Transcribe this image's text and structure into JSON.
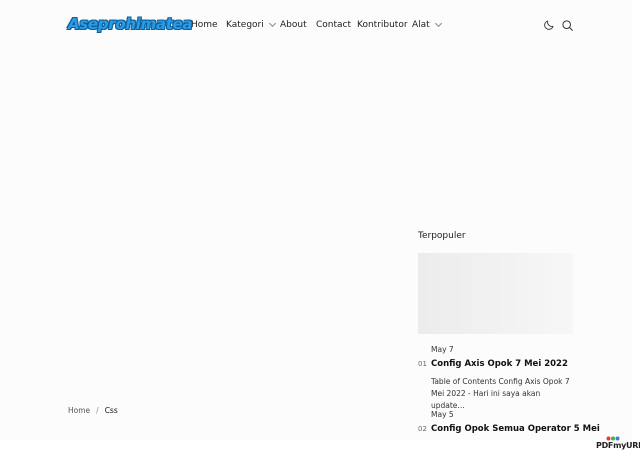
{
  "header": {
    "logo_text": "Aseprohimatea",
    "nav": [
      {
        "label": "Home",
        "has_dropdown": false
      },
      {
        "label": "Kategori",
        "has_dropdown": true
      },
      {
        "label": "About",
        "has_dropdown": false
      },
      {
        "label": "Contact",
        "has_dropdown": false
      },
      {
        "label": "Kontributor",
        "has_dropdown": false
      },
      {
        "label": "Alat",
        "has_dropdown": true
      }
    ],
    "icons": [
      "moon-icon",
      "search-icon"
    ]
  },
  "sidebar": {
    "title": "Terpopuler",
    "posts": [
      {
        "number": "01",
        "date": "May 7",
        "title": "Config Axis Opok 7 Mei 2022",
        "excerpt": "Table of Contents   Config Axis Opok 7 Mei 2022  - Hari ini saya akan update…"
      },
      {
        "number": "02",
        "date": "May 5",
        "title": "Config Opok Semua Operator 5 Mei"
      }
    ]
  },
  "breadcrumb": {
    "home": "Home",
    "separator": "/",
    "current": "Css"
  },
  "watermark": "PDFmyURL",
  "colors": {
    "logo": "#2c9be6",
    "logo_outline": "#0d5f99",
    "background": "#fcfcfc",
    "text": "#222222"
  }
}
